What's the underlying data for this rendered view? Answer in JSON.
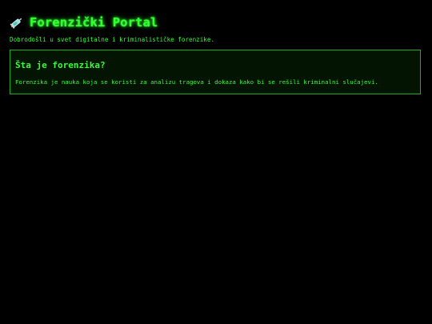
{
  "header": {
    "title": "Forenzički Portal",
    "logo_icon": "syringe-icon"
  },
  "intro": "Dobrodošli u svet digitalne i kriminalističke forenzike.",
  "card": {
    "heading": "Šta je forenzika?",
    "text": "Forenzika je nauka koja se koristi za analizu tragova i dokaza kako bi se rešili kriminalni slučajevi."
  },
  "colors": {
    "background": "#000000",
    "accent": "#33ff33",
    "card_border": "#22aa22"
  }
}
